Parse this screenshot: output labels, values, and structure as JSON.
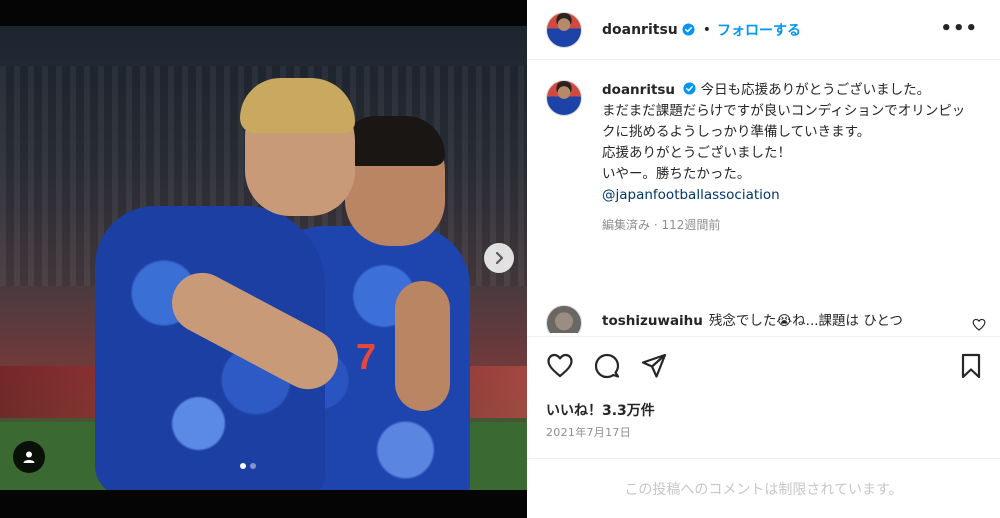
{
  "header": {
    "username": "doanritsu",
    "separator": "•",
    "follow_label": "フォローする",
    "more_label": "•••"
  },
  "caption": {
    "username": "doanritsu",
    "lines": [
      "今日も応援ありがとうございました。",
      "まだまだ課題だらけですが良いコンディションでオリンピックに挑めるようしっかり準備していきます。",
      "応援ありがとうございました！",
      "いやー。勝ちたかった。"
    ],
    "mention": "@japanfootballassociation",
    "meta": "編集済み · 112週間前"
  },
  "comment": {
    "username": "toshizuwaihu",
    "text": "残念でした😭ね...課題は ひとつ"
  },
  "photo": {
    "jersey_number": "7"
  },
  "likes": "いいね！3.3万件",
  "date": "2021年7月17日",
  "add_comment_placeholder": "この投稿へのコメントは制限されています。",
  "icons": {
    "verified": "verified-badge-icon",
    "like": "heart-icon",
    "comment": "comment-icon",
    "share": "share-icon",
    "save": "bookmark-icon",
    "next": "chevron-right-icon",
    "tagged": "user-tag-icon"
  },
  "colors": {
    "accent": "#0095f6",
    "text": "#262626",
    "muted": "#8e8e8e",
    "mention": "#00376b"
  }
}
